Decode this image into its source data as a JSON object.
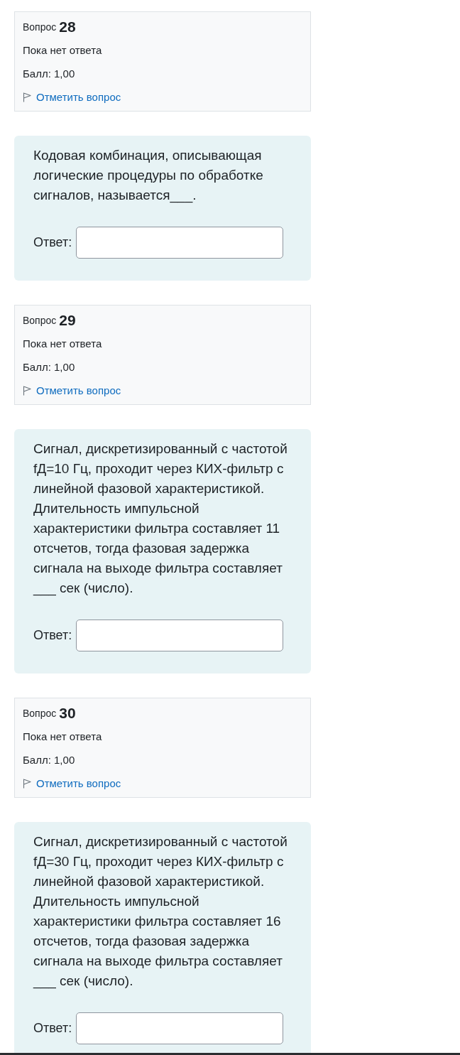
{
  "questions": [
    {
      "label": "Вопрос",
      "number": "28",
      "status": "Пока нет ответа",
      "grade": "Балл: 1,00",
      "flag_link": "Отметить вопрос",
      "flagged": false,
      "text": "Кодовая комбинация, описывающая логические процедуры по обработке сигналов, называется___.",
      "answer_label": "Ответ:"
    },
    {
      "label": "Вопрос",
      "number": "29",
      "status": "Пока нет ответа",
      "grade": "Балл: 1,00",
      "flag_link": "Отметить вопрос",
      "flagged": false,
      "text": "Сигнал, дискретизированный с частотой fД=10 Гц, проходит через КИХ-фильтр с линейной фазовой характеристикой. Длительность импульсной характеристики фильтра составляет 11 отсчетов, тогда фазовая задержка сигнала на выходе фильтра составляет ___ сек (число).",
      "answer_label": "Ответ:"
    },
    {
      "label": "Вопрос",
      "number": "30",
      "status": "Пока нет ответа",
      "grade": "Балл: 1,00",
      "flag_link": "Отметить вопрос",
      "flagged": false,
      "text": "Сигнал, дискретизированный с частотой fД=30 Гц, проходит через КИХ-фильтр с линейной фазовой характеристикой. Длительность импульсной характеристики фильтра составляет 16 отсчетов, тогда фазовая задержка сигнала на выходе фильтра составляет ___ сек (число).",
      "answer_label": "Ответ:"
    }
  ]
}
